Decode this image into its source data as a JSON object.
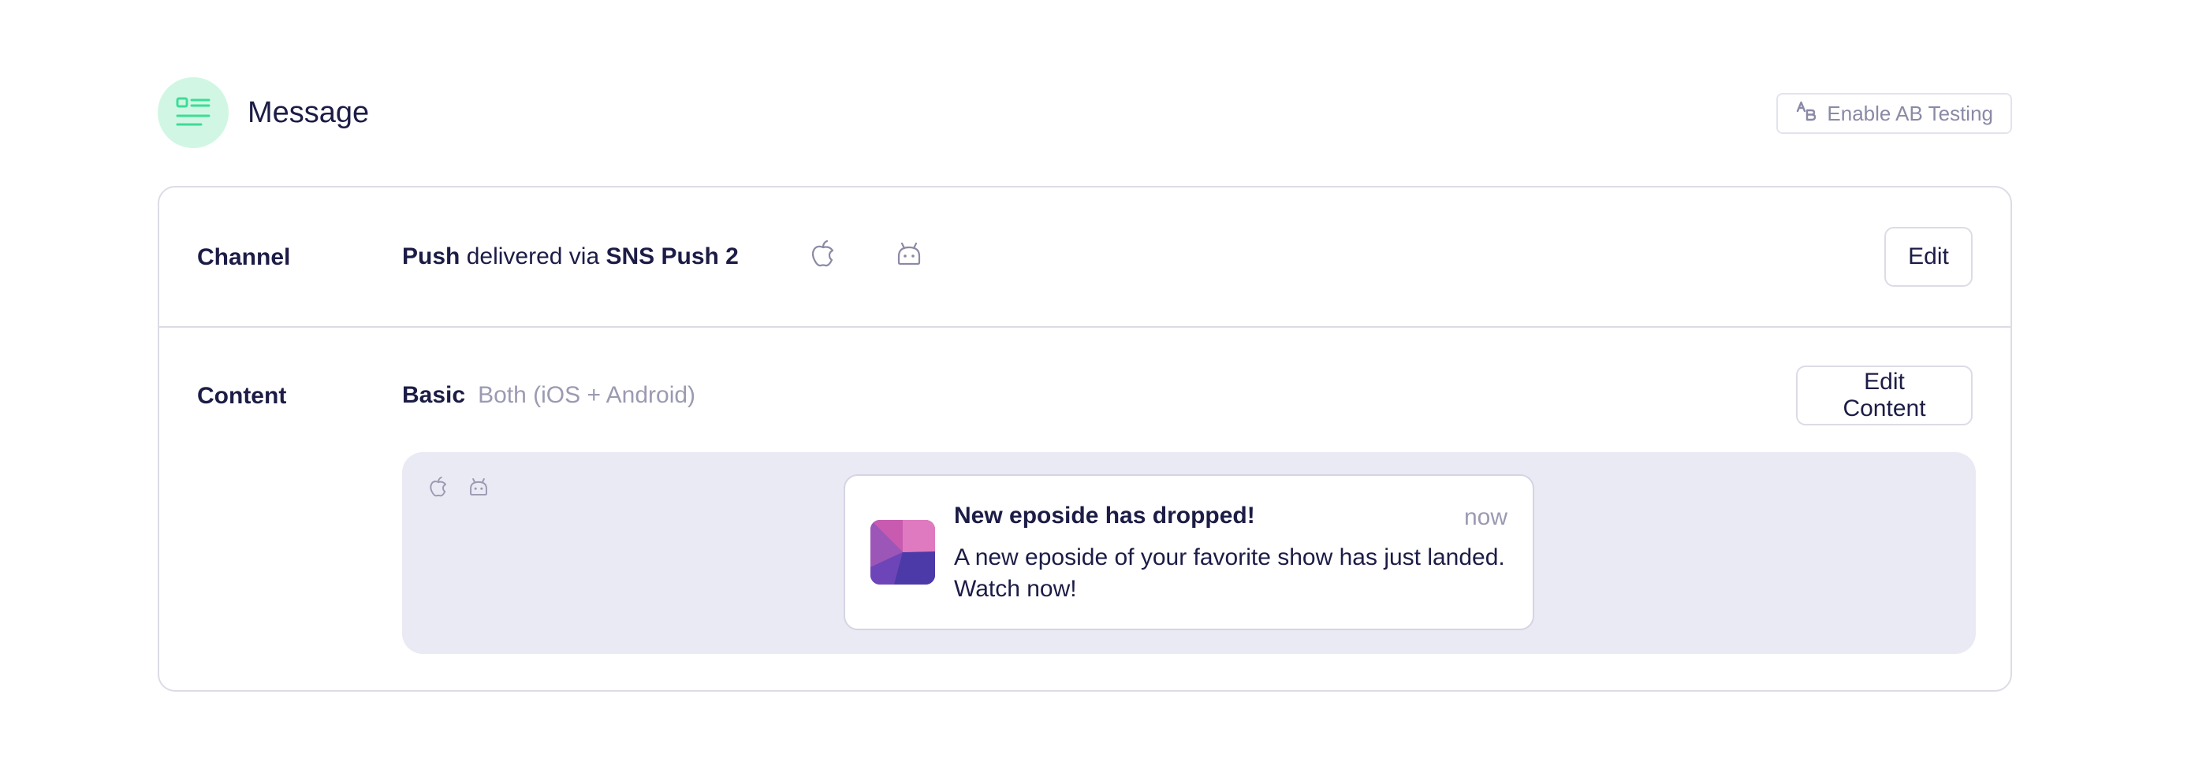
{
  "header": {
    "title": "Message",
    "icon": "message-list-icon",
    "ab_button_label": "Enable AB Testing",
    "ab_button_icon": "ab-testing-icon"
  },
  "channel": {
    "label": "Channel",
    "type": "Push",
    "connector_text": " delivered via ",
    "provider": "SNS Push 2",
    "platform_icons": [
      "apple-icon",
      "android-icon"
    ],
    "edit_label": "Edit"
  },
  "content": {
    "label": "Content",
    "type": "Basic",
    "platforms": "Both (iOS + Android)",
    "edit_label": "Edit Content"
  },
  "preview": {
    "platform_icons": [
      "apple-icon",
      "android-icon"
    ],
    "notification": {
      "title": "New eposide has dropped!",
      "time": "now",
      "body": "A new eposide of your favorite show has just landed. Watch now!"
    }
  },
  "colors": {
    "accent_green": "#3ddc97",
    "accent_green_bg": "#d1f7e4",
    "text_primary": "#1c1c46",
    "text_muted": "#9a9ab2",
    "preview_bg": "#eaeaf5",
    "border": "#dcdce6"
  }
}
